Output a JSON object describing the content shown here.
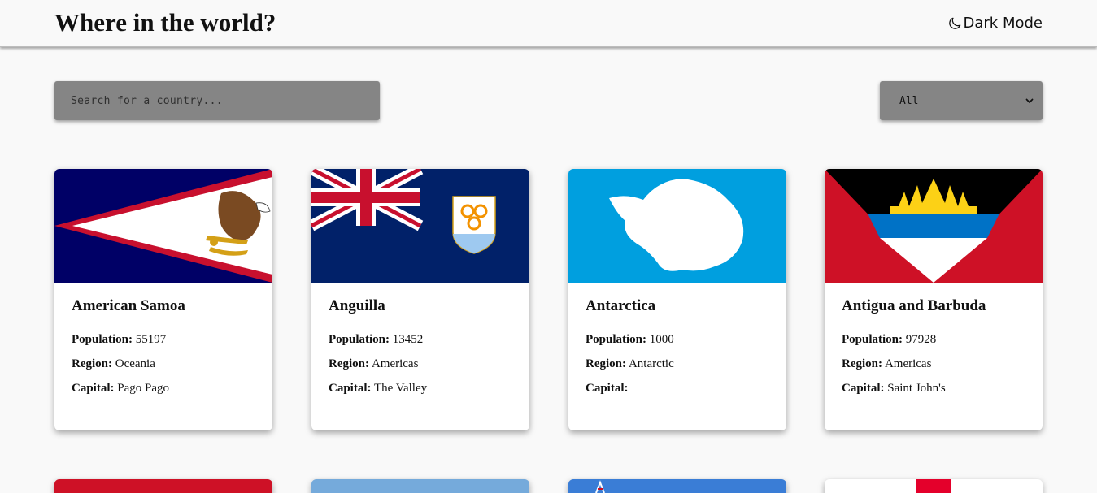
{
  "header": {
    "title": "Where in the world?",
    "mode_label": "Dark Mode",
    "mode_icon": "moon-icon"
  },
  "search": {
    "placeholder": "Search for a country..."
  },
  "filter": {
    "selected": "All",
    "icon": "chevron-down-icon"
  },
  "labels": {
    "population": "Population:",
    "region": "Region:",
    "capital": "Capital:"
  },
  "countries": [
    {
      "name": "American Samoa",
      "population": "55197",
      "region": "Oceania",
      "capital": "Pago Pago"
    },
    {
      "name": "Anguilla",
      "population": "13452",
      "region": "Americas",
      "capital": "The Valley"
    },
    {
      "name": "Antarctica",
      "population": "1000",
      "region": "Antarctic",
      "capital": ""
    },
    {
      "name": "Antigua and Barbuda",
      "population": "97928",
      "region": "Americas",
      "capital": "Saint John's"
    }
  ],
  "colors": {
    "background": "#f9f9f9",
    "control_bg": "#858585",
    "card_bg": "#ffffff"
  }
}
